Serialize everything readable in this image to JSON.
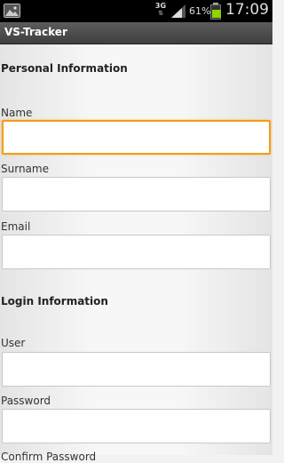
{
  "status_bar": {
    "network": "3G",
    "battery_percent": "61%",
    "battery_level": 0.61,
    "time": "17:09",
    "icons": [
      "gallery-icon",
      "network-3g-icon",
      "signal-icon",
      "battery-icon"
    ]
  },
  "action_bar": {
    "title": "VS-Tracker"
  },
  "form": {
    "personal_section": "Personal Information",
    "name_label": "Name",
    "name_value": "",
    "surname_label": "Surname",
    "surname_value": "",
    "email_label": "Email",
    "email_value": "",
    "login_section": "Login Information",
    "user_label": "User",
    "user_value": "",
    "password_label": "Password",
    "password_value": "",
    "confirm_password_label": "Confirm Password"
  },
  "colors": {
    "focus_border": "#f39c1b",
    "battery_fill": "#8fd400",
    "action_bar": "#4a4a4a"
  }
}
